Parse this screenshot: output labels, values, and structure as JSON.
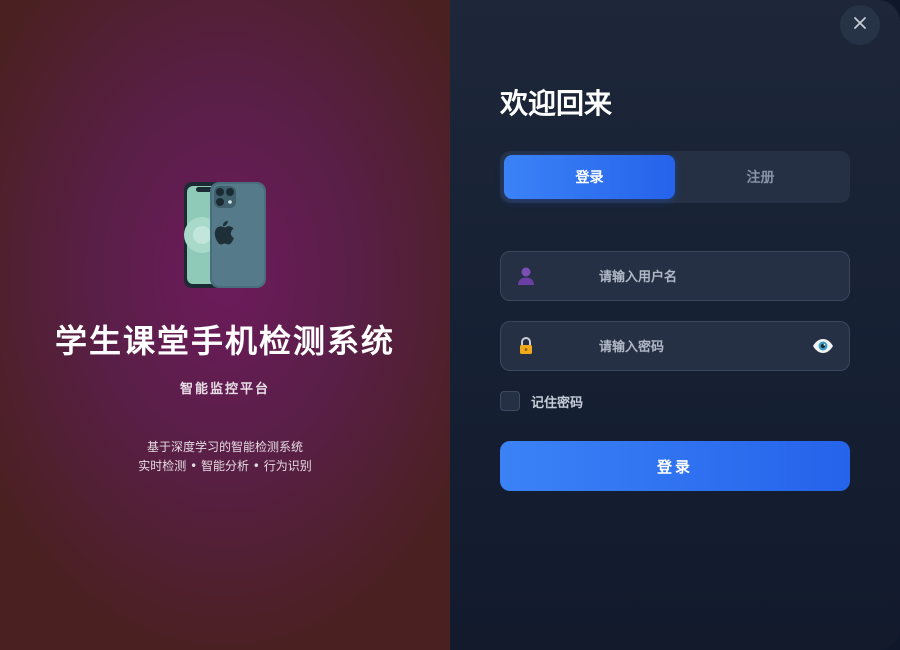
{
  "branding": {
    "title": "学生课堂手机检测系统",
    "subtitle": "智能监控平台",
    "desc_line1": "基于深度学习的智能检测系统",
    "desc_line2": "实时检测 • 智能分析 • 行为识别",
    "illustration": "smartphone-icon"
  },
  "window": {
    "close_icon": "close-icon"
  },
  "login_panel": {
    "welcome": "欢迎回来",
    "tabs": [
      {
        "label": "登录",
        "active": true
      },
      {
        "label": "注册",
        "active": false
      }
    ],
    "username": {
      "placeholder": "请输入用户名",
      "value": "",
      "icon": "user-icon"
    },
    "password": {
      "placeholder": "请输入密码",
      "value": "",
      "icon": "lock-icon",
      "toggle_icon": "eye-icon"
    },
    "remember_label": "记住密码",
    "remember_checked": false,
    "submit_label": "登录"
  },
  "colors": {
    "accent": "#3b82f6",
    "accent_dark": "#2563eb",
    "panel_bg": "#1d2739",
    "field_bg": "#253044",
    "left_bg": "#6d1a5c"
  }
}
